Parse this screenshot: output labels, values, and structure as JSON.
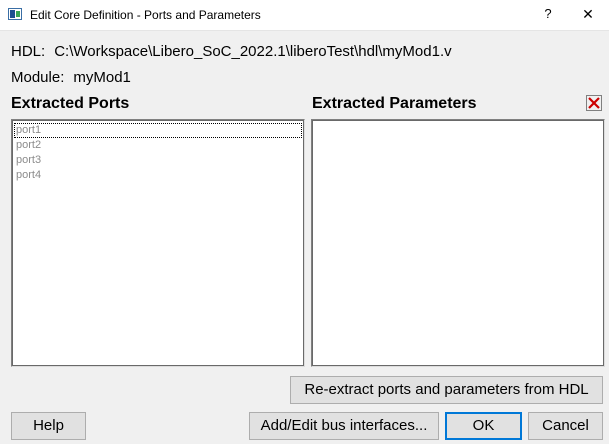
{
  "window": {
    "title": "Edit Core Definition - Ports and Parameters",
    "help_glyph": "?",
    "close_glyph": "✕"
  },
  "info": {
    "hdl_label": "HDL:",
    "hdl_value": "C:\\Workspace\\Libero_SoC_2022.1\\liberoTest\\hdl\\myMod1.v",
    "module_label": "Module:",
    "module_value": "myMod1"
  },
  "ports": {
    "heading": "Extracted Ports",
    "items": [
      "port1",
      "port2",
      "port3",
      "port4"
    ]
  },
  "parameters": {
    "heading": "Extracted Parameters",
    "items": []
  },
  "buttons": {
    "reextract": "Re-extract ports and parameters from HDL",
    "help": "Help",
    "add_edit_bus": "Add/Edit bus interfaces...",
    "ok": "OK",
    "cancel": "Cancel"
  },
  "icons": {
    "app": "libero-app-icon",
    "delete": "red-x-delete-icon"
  },
  "colors": {
    "dialog_bg": "#f0f0f0",
    "list_bg": "#ffffff",
    "disabled_text": "#8c8c8c",
    "delete_red": "#cc0000",
    "default_button_border": "#0078d7"
  }
}
